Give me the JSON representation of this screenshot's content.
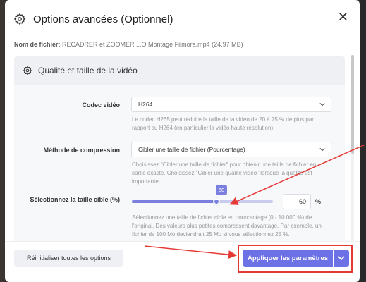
{
  "dialog": {
    "title": "Options avancées (Optionnel)",
    "close_symbol": "✕",
    "file": {
      "label": "Nom de fichier:",
      "value": "RECADRER et ZOOMER ...O Montage Filmora.mp4 (24.97 MB)"
    }
  },
  "section": {
    "title": "Qualité et taille de la vidéo",
    "codec": {
      "label": "Codec vidéo",
      "value": "H264",
      "help_1": "Le codec H265 peut réduire la taille de la vidéo de 20 à 75 % de plus par",
      "help_2": "rapport au H264 (en particulier la vidéo haute résolution)"
    },
    "compression": {
      "label": "Méthode de compression",
      "value": "Cibler une taille de fichier (Pourcentage)",
      "help_1": "Choisissez \"Cibler une taille de fichier\" pour obtenir une taille de fichier en",
      "help_2": "sortie exacte. Choisissez \"Cibler une qualité vidéo\" lorsque la qualité est",
      "help_3": "importante."
    },
    "target": {
      "label": "Sélectionnez la taille cible (%)",
      "slider_value": 60,
      "slider_display": "60",
      "input_value": "60",
      "unit": "%",
      "help_1": "Sélectionnez une taille de fichier cible en pourcentage (0 - 10 000 %) de",
      "help_2": "l'original. Des valeurs plus petites compressent davantage. Par exemple, un",
      "help_3": "fichier de 100 Mo deviendrait 25 Mo si vous sélectionnez 25 %."
    }
  },
  "footer": {
    "reset_label": "Réinitialiser toutes les options",
    "apply_label": "Appliquer les paramètres"
  },
  "colors": {
    "accent": "#6c72e6",
    "annotation": "#e53935"
  },
  "icons": [
    "gear-icon",
    "close-icon",
    "chevron-down-icon"
  ]
}
